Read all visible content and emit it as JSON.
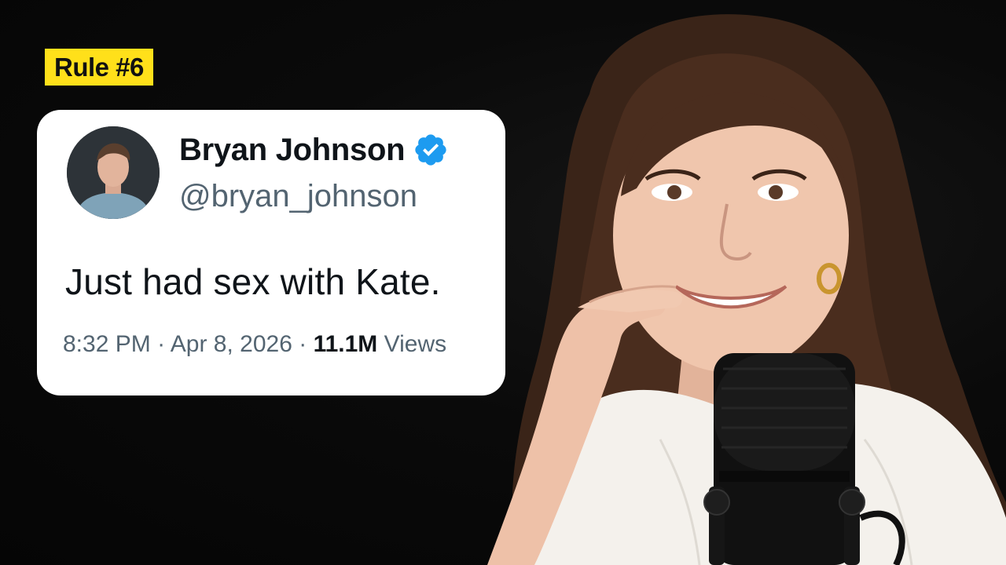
{
  "badge": {
    "label": "Rule #6",
    "color": "#ffe01a"
  },
  "tweet": {
    "name": "Bryan Johnson",
    "handle": "@bryan_johnson",
    "text": "Just had sex with Kate.",
    "time": "8:32 PM",
    "separator": "·",
    "date": "Apr 8, 2026",
    "views_count": "11.1M",
    "views_label": "Views",
    "verified_color": "#1d9bf0",
    "verified_icon": "verified-badge-icon",
    "avatar_icon": "user-avatar"
  },
  "scene": {
    "subject": "woman-smiling-at-microphone",
    "background_color": "#070707"
  }
}
